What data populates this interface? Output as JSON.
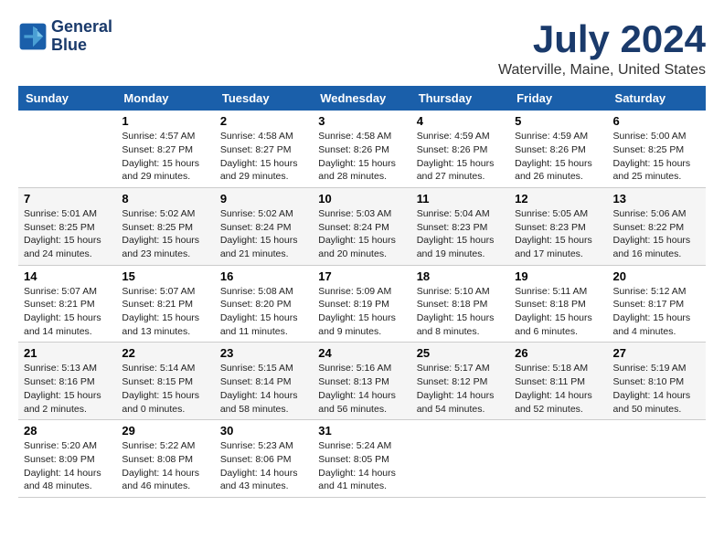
{
  "logo": {
    "line1": "General",
    "line2": "Blue"
  },
  "title": "July 2024",
  "location": "Waterville, Maine, United States",
  "days_header": [
    "Sunday",
    "Monday",
    "Tuesday",
    "Wednesday",
    "Thursday",
    "Friday",
    "Saturday"
  ],
  "weeks": [
    [
      {
        "day": "",
        "sunrise": "",
        "sunset": "",
        "daylight": ""
      },
      {
        "day": "1",
        "sunrise": "Sunrise: 4:57 AM",
        "sunset": "Sunset: 8:27 PM",
        "daylight": "Daylight: 15 hours and 29 minutes."
      },
      {
        "day": "2",
        "sunrise": "Sunrise: 4:58 AM",
        "sunset": "Sunset: 8:27 PM",
        "daylight": "Daylight: 15 hours and 29 minutes."
      },
      {
        "day": "3",
        "sunrise": "Sunrise: 4:58 AM",
        "sunset": "Sunset: 8:26 PM",
        "daylight": "Daylight: 15 hours and 28 minutes."
      },
      {
        "day": "4",
        "sunrise": "Sunrise: 4:59 AM",
        "sunset": "Sunset: 8:26 PM",
        "daylight": "Daylight: 15 hours and 27 minutes."
      },
      {
        "day": "5",
        "sunrise": "Sunrise: 4:59 AM",
        "sunset": "Sunset: 8:26 PM",
        "daylight": "Daylight: 15 hours and 26 minutes."
      },
      {
        "day": "6",
        "sunrise": "Sunrise: 5:00 AM",
        "sunset": "Sunset: 8:25 PM",
        "daylight": "Daylight: 15 hours and 25 minutes."
      }
    ],
    [
      {
        "day": "7",
        "sunrise": "Sunrise: 5:01 AM",
        "sunset": "Sunset: 8:25 PM",
        "daylight": "Daylight: 15 hours and 24 minutes."
      },
      {
        "day": "8",
        "sunrise": "Sunrise: 5:02 AM",
        "sunset": "Sunset: 8:25 PM",
        "daylight": "Daylight: 15 hours and 23 minutes."
      },
      {
        "day": "9",
        "sunrise": "Sunrise: 5:02 AM",
        "sunset": "Sunset: 8:24 PM",
        "daylight": "Daylight: 15 hours and 21 minutes."
      },
      {
        "day": "10",
        "sunrise": "Sunrise: 5:03 AM",
        "sunset": "Sunset: 8:24 PM",
        "daylight": "Daylight: 15 hours and 20 minutes."
      },
      {
        "day": "11",
        "sunrise": "Sunrise: 5:04 AM",
        "sunset": "Sunset: 8:23 PM",
        "daylight": "Daylight: 15 hours and 19 minutes."
      },
      {
        "day": "12",
        "sunrise": "Sunrise: 5:05 AM",
        "sunset": "Sunset: 8:23 PM",
        "daylight": "Daylight: 15 hours and 17 minutes."
      },
      {
        "day": "13",
        "sunrise": "Sunrise: 5:06 AM",
        "sunset": "Sunset: 8:22 PM",
        "daylight": "Daylight: 15 hours and 16 minutes."
      }
    ],
    [
      {
        "day": "14",
        "sunrise": "Sunrise: 5:07 AM",
        "sunset": "Sunset: 8:21 PM",
        "daylight": "Daylight: 15 hours and 14 minutes."
      },
      {
        "day": "15",
        "sunrise": "Sunrise: 5:07 AM",
        "sunset": "Sunset: 8:21 PM",
        "daylight": "Daylight: 15 hours and 13 minutes."
      },
      {
        "day": "16",
        "sunrise": "Sunrise: 5:08 AM",
        "sunset": "Sunset: 8:20 PM",
        "daylight": "Daylight: 15 hours and 11 minutes."
      },
      {
        "day": "17",
        "sunrise": "Sunrise: 5:09 AM",
        "sunset": "Sunset: 8:19 PM",
        "daylight": "Daylight: 15 hours and 9 minutes."
      },
      {
        "day": "18",
        "sunrise": "Sunrise: 5:10 AM",
        "sunset": "Sunset: 8:18 PM",
        "daylight": "Daylight: 15 hours and 8 minutes."
      },
      {
        "day": "19",
        "sunrise": "Sunrise: 5:11 AM",
        "sunset": "Sunset: 8:18 PM",
        "daylight": "Daylight: 15 hours and 6 minutes."
      },
      {
        "day": "20",
        "sunrise": "Sunrise: 5:12 AM",
        "sunset": "Sunset: 8:17 PM",
        "daylight": "Daylight: 15 hours and 4 minutes."
      }
    ],
    [
      {
        "day": "21",
        "sunrise": "Sunrise: 5:13 AM",
        "sunset": "Sunset: 8:16 PM",
        "daylight": "Daylight: 15 hours and 2 minutes."
      },
      {
        "day": "22",
        "sunrise": "Sunrise: 5:14 AM",
        "sunset": "Sunset: 8:15 PM",
        "daylight": "Daylight: 15 hours and 0 minutes."
      },
      {
        "day": "23",
        "sunrise": "Sunrise: 5:15 AM",
        "sunset": "Sunset: 8:14 PM",
        "daylight": "Daylight: 14 hours and 58 minutes."
      },
      {
        "day": "24",
        "sunrise": "Sunrise: 5:16 AM",
        "sunset": "Sunset: 8:13 PM",
        "daylight": "Daylight: 14 hours and 56 minutes."
      },
      {
        "day": "25",
        "sunrise": "Sunrise: 5:17 AM",
        "sunset": "Sunset: 8:12 PM",
        "daylight": "Daylight: 14 hours and 54 minutes."
      },
      {
        "day": "26",
        "sunrise": "Sunrise: 5:18 AM",
        "sunset": "Sunset: 8:11 PM",
        "daylight": "Daylight: 14 hours and 52 minutes."
      },
      {
        "day": "27",
        "sunrise": "Sunrise: 5:19 AM",
        "sunset": "Sunset: 8:10 PM",
        "daylight": "Daylight: 14 hours and 50 minutes."
      }
    ],
    [
      {
        "day": "28",
        "sunrise": "Sunrise: 5:20 AM",
        "sunset": "Sunset: 8:09 PM",
        "daylight": "Daylight: 14 hours and 48 minutes."
      },
      {
        "day": "29",
        "sunrise": "Sunrise: 5:22 AM",
        "sunset": "Sunset: 8:08 PM",
        "daylight": "Daylight: 14 hours and 46 minutes."
      },
      {
        "day": "30",
        "sunrise": "Sunrise: 5:23 AM",
        "sunset": "Sunset: 8:06 PM",
        "daylight": "Daylight: 14 hours and 43 minutes."
      },
      {
        "day": "31",
        "sunrise": "Sunrise: 5:24 AM",
        "sunset": "Sunset: 8:05 PM",
        "daylight": "Daylight: 14 hours and 41 minutes."
      },
      {
        "day": "",
        "sunrise": "",
        "sunset": "",
        "daylight": ""
      },
      {
        "day": "",
        "sunrise": "",
        "sunset": "",
        "daylight": ""
      },
      {
        "day": "",
        "sunrise": "",
        "sunset": "",
        "daylight": ""
      }
    ]
  ]
}
